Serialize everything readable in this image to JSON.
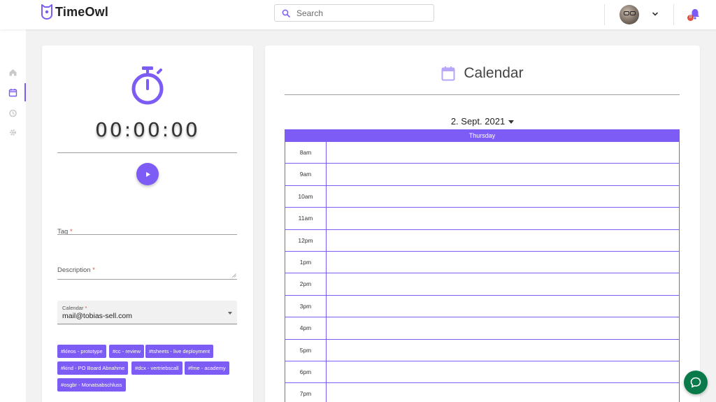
{
  "app": {
    "name": "TimeOwl"
  },
  "header": {
    "search_placeholder": "Search",
    "notifications_count": "0"
  },
  "nav": {
    "items": [
      {
        "name": "home-icon",
        "active": false
      },
      {
        "name": "calendar-icon",
        "active": true
      },
      {
        "name": "history-icon",
        "active": false
      },
      {
        "name": "settings-icon",
        "active": false
      }
    ]
  },
  "timer": {
    "display": "00:00:00",
    "tag_label": "Tag",
    "description_label": "Description",
    "required_mark": "*",
    "calendar_label": "Calendar",
    "calendar_value": "mail@tobias-sell.com",
    "tags": [
      "#kleos - prototype",
      "#cc - review",
      "#tsheets - live deployment",
      "#kind - PO Board Abnahme",
      "#dcx - vertriebscall",
      "#fme - academy",
      "#osgbr - Monatsabschluss"
    ]
  },
  "calendar": {
    "title": "Calendar",
    "date": "2. Sept. 2021",
    "day": "Thursday",
    "hours": [
      "8am",
      "9am",
      "10am",
      "11am",
      "12pm",
      "1pm",
      "2pm",
      "3pm",
      "4pm",
      "5pm",
      "6pm",
      "7pm"
    ]
  },
  "colors": {
    "accent": "#7c5cf4",
    "chat": "#0a7a4a",
    "required": "#e0513f"
  }
}
